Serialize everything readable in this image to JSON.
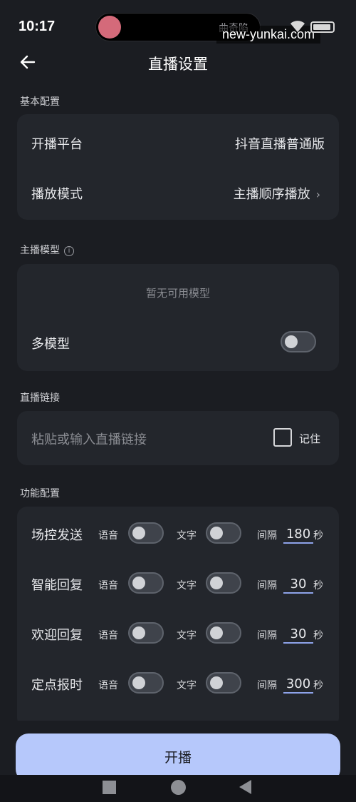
{
  "status_bar": {
    "time": "10:17",
    "island_text": "曲奇陷"
  },
  "watermark": "new-yunkai.com",
  "header": {
    "title": "直播设置"
  },
  "basic": {
    "section_label": "基本配置",
    "platform_label": "开播平台",
    "platform_value": "抖音直播普通版",
    "mode_label": "播放模式",
    "mode_value": "主播顺序播放",
    "mode_chevron": "›"
  },
  "model": {
    "section_label": "主播模型",
    "info_glyph": "i",
    "empty_text": "暂无可用模型",
    "multi_label": "多模型"
  },
  "link": {
    "section_label": "直播链接",
    "placeholder": "粘贴或输入直播链接",
    "remember_label": "记住"
  },
  "functions": {
    "section_label": "功能配置",
    "voice_label": "语音",
    "text_label": "文字",
    "interval_label": "间隔",
    "unit": "秒",
    "rows": [
      {
        "label": "场控发送",
        "interval": "180"
      },
      {
        "label": "智能回复",
        "interval": "30"
      },
      {
        "label": "欢迎回复",
        "interval": "30"
      },
      {
        "label": "定点报时",
        "interval": "300"
      }
    ]
  },
  "start_button": "开播"
}
